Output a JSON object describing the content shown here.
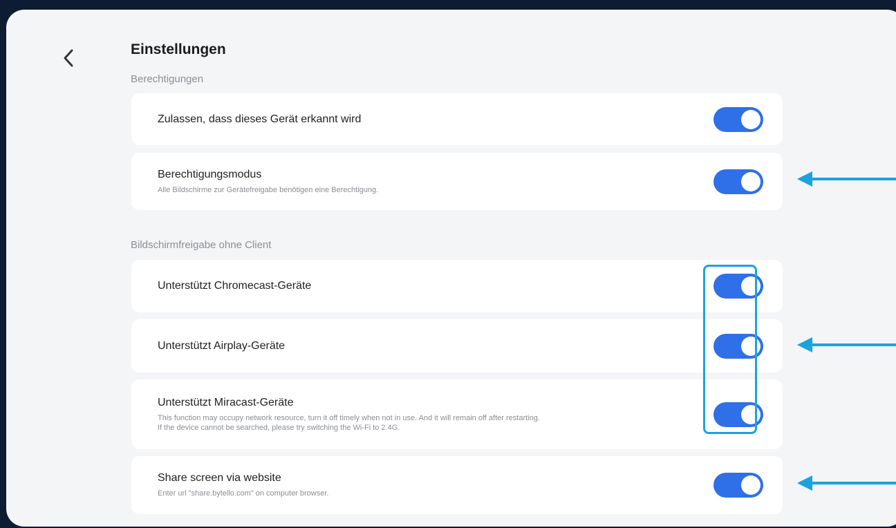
{
  "header": {
    "title": "Einstellungen",
    "back_icon": "chevron-left-icon"
  },
  "sections": [
    {
      "heading": "Berechtigungen",
      "items": [
        {
          "label": "Zulassen, dass dieses Gerät erkannt wird",
          "desc": "",
          "enabled": true
        },
        {
          "label": "Berechtigungsmodus",
          "desc": "Alle Bildschirme zur Gerätefreigabe benötigen eine Berechtigung.",
          "enabled": true
        }
      ]
    },
    {
      "heading": "Bildschirmfreigabe ohne Client",
      "items": [
        {
          "label": "Unterstützt Chromecast-Geräte",
          "desc": "",
          "enabled": true
        },
        {
          "label": "Unterstützt Airplay-Geräte",
          "desc": "",
          "enabled": true
        },
        {
          "label": "Unterstützt Miracast-Geräte",
          "desc_line1": "This function may occupy network resource, turn it off timely when not in use. And it will remain off after restarting.",
          "desc_line2": "If the device cannot be searched, please try switching the Wi-Fi to 2.4G.",
          "enabled": true
        },
        {
          "label": "Share screen via website",
          "desc": "Enter url \"share.bytello.com\" on computer browser.",
          "enabled": true
        }
      ]
    }
  ],
  "colors": {
    "toggle_on": "#2f6fe8",
    "annotation": "#1aa3dd",
    "panel_bg": "#f4f5f7",
    "outer_bg": "#0d1b33"
  }
}
